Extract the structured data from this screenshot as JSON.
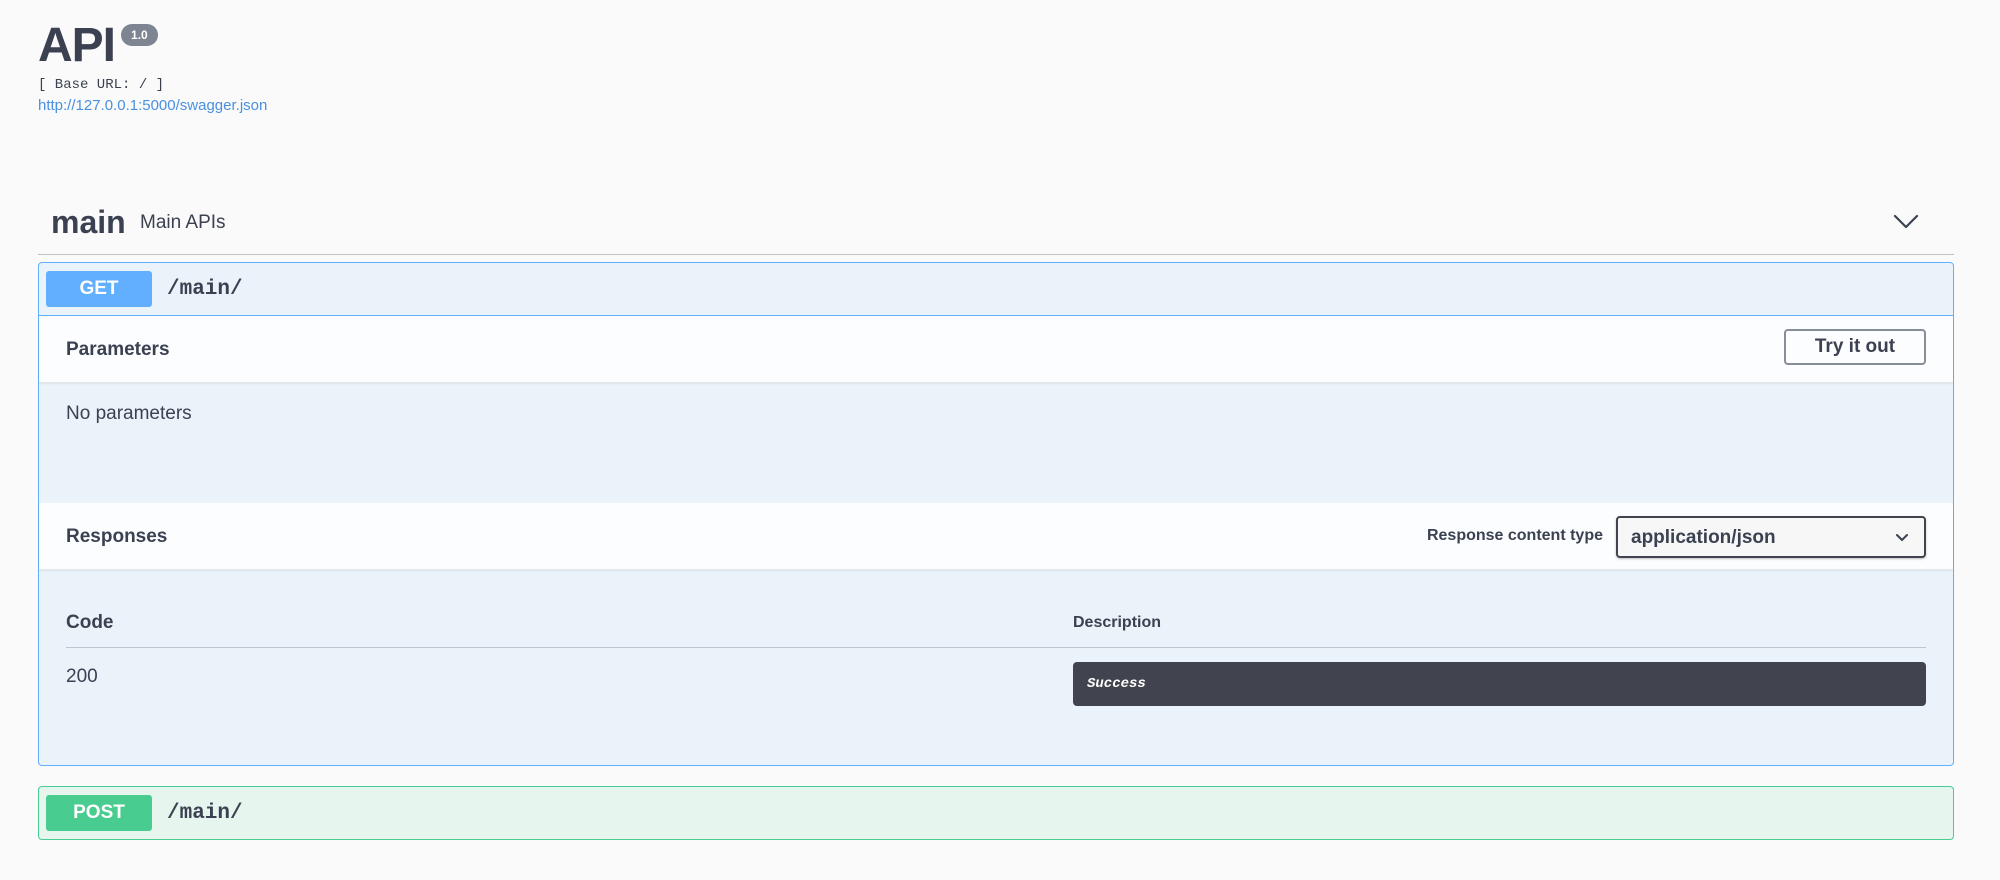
{
  "header": {
    "title": "API",
    "version": "1.0",
    "base_url": "[ Base URL: / ]",
    "spec_link": "http://127.0.0.1:5000/swagger.json"
  },
  "tag": {
    "name": "main",
    "description": "Main APIs",
    "chevron_icon": "chevron-down-icon"
  },
  "operations": [
    {
      "method": "GET",
      "path": "/main/",
      "color": "#61affe",
      "expanded": true,
      "parameters": {
        "title": "Parameters",
        "try_button": "Try it out",
        "empty_text": "No parameters"
      },
      "responses": {
        "title": "Responses",
        "content_type_label": "Response content type",
        "content_type_value": "application/json",
        "columns": [
          "Code",
          "Description"
        ],
        "rows": [
          {
            "code": "200",
            "description": "Success"
          }
        ]
      }
    },
    {
      "method": "POST",
      "path": "/main/",
      "color": "#49cc90",
      "expanded": false
    }
  ],
  "colors": {
    "text": "#3b4151",
    "link": "#4990e2",
    "get": "#61affe",
    "post": "#49cc90",
    "dark_box": "#41444e"
  }
}
